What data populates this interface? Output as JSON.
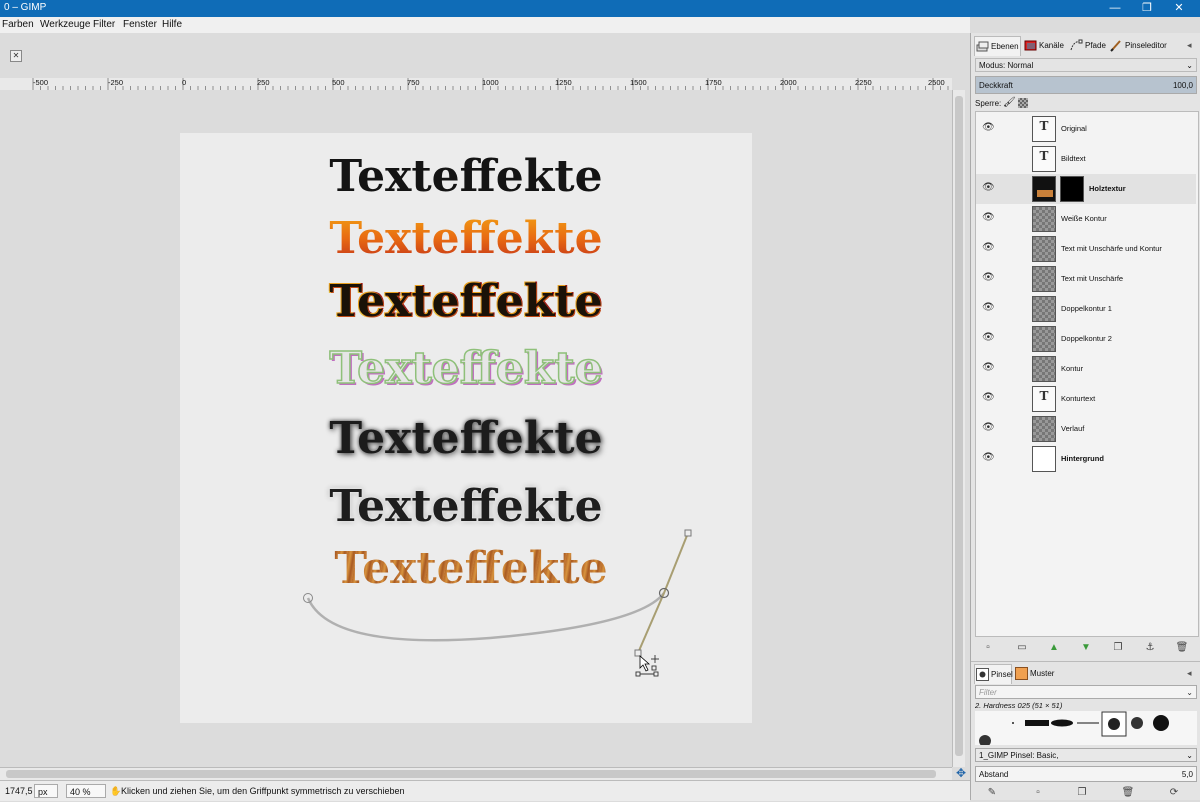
{
  "window": {
    "title": "0 – GIMP",
    "controls": {
      "minimize": "—",
      "maximize": "❐",
      "close": "✕"
    }
  },
  "menu": [
    "Farben",
    "Werkzeuge",
    "Filter",
    "Fenster",
    "Hilfe"
  ],
  "ruler": {
    "labels": [
      "-500",
      "-250",
      "0",
      "250",
      "500",
      "750",
      "1000",
      "1250",
      "1500",
      "1750",
      "2000",
      "2250",
      "2500"
    ]
  },
  "image": {
    "lines": [
      {
        "text": "Texteffekte",
        "style": "black"
      },
      {
        "text": "Texteffekte",
        "style": "orange-gradient"
      },
      {
        "text": "Texteffekte",
        "style": "double-outline"
      },
      {
        "text": "Texteffekte",
        "style": "outline"
      },
      {
        "text": "Texteffekte",
        "style": "blurred"
      },
      {
        "text": "Texteffekte",
        "style": "blurred-outline"
      },
      {
        "text": "Texteffekte",
        "style": "wood"
      }
    ]
  },
  "status": {
    "coords": "1747,5",
    "unit": "px",
    "zoom": "40 %",
    "message": "Klicken und ziehen Sie, um den Griffpunkt symmetrisch zu verschieben"
  },
  "dock": {
    "tabs": [
      "Ebenen",
      "Kanäle",
      "Pfade",
      "Pinseleditor"
    ],
    "mode_label": "Modus: Normal",
    "opacity_label": "Deckkraft",
    "opacity_value": "100,0",
    "lock_label": "Sperre:",
    "layers": [
      {
        "name": "Original",
        "visible": true,
        "thumb": "text",
        "bold": false,
        "selected": false
      },
      {
        "name": "Bildtext",
        "visible": false,
        "thumb": "text",
        "bold": false,
        "selected": false
      },
      {
        "name": "Holztextur",
        "visible": true,
        "thumb": "wood",
        "bold": true,
        "selected": true
      },
      {
        "name": "Weiße Kontur",
        "visible": true,
        "thumb": "checker",
        "bold": false,
        "selected": false
      },
      {
        "name": "Text mit Unschärfe und Kontur",
        "visible": true,
        "thumb": "checker",
        "bold": false,
        "selected": false
      },
      {
        "name": "Text mit Unschärfe",
        "visible": true,
        "thumb": "checker",
        "bold": false,
        "selected": false
      },
      {
        "name": "Doppelkontur 1",
        "visible": true,
        "thumb": "checker",
        "bold": false,
        "selected": false
      },
      {
        "name": "Doppelkontur 2",
        "visible": true,
        "thumb": "checker",
        "bold": false,
        "selected": false
      },
      {
        "name": "Kontur",
        "visible": true,
        "thumb": "checker",
        "bold": false,
        "selected": false
      },
      {
        "name": "Konturtext",
        "visible": true,
        "thumb": "text",
        "bold": false,
        "selected": false
      },
      {
        "name": "Verlauf",
        "visible": true,
        "thumb": "checker",
        "bold": false,
        "selected": false
      },
      {
        "name": "Hintergrund",
        "visible": true,
        "thumb": "white",
        "bold": true,
        "selected": false
      }
    ],
    "brush_tabs": [
      "Pinsel",
      "Muster"
    ],
    "filter_placeholder": "Filter",
    "brush_name": "2. Hardness 025 (51 × 51)",
    "brush_preset": "1_GIMP Pinsel: Basic,",
    "spacing_label": "Abstand",
    "spacing_value": "5,0"
  }
}
